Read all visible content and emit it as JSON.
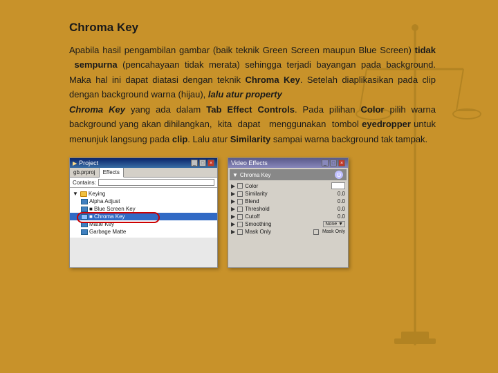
{
  "page": {
    "background_color": "#c8922a"
  },
  "title": "Chroma Key",
  "paragraph": {
    "text_parts": [
      {
        "text": "Apabila hasil pengambilan gambar (baik teknik Green Screen maupun Blue Screen) ",
        "style": "normal"
      },
      {
        "text": "tidak sempurna",
        "style": "bold"
      },
      {
        "text": " (pencahayaan tidak merata) sehingga terjadi bayangan pada background. Maka hal ini dapat diatasi dengan teknik ",
        "style": "normal"
      },
      {
        "text": "Chroma Key",
        "style": "bold"
      },
      {
        "text": ". Setelah diaplikasikan pada clip dengan background warna (hijau), ",
        "style": "normal"
      },
      {
        "text": "lalu atur property Chroma Key",
        "style": "bold-italic"
      },
      {
        "text": " yang ada dalam ",
        "style": "normal"
      },
      {
        "text": "Tab Effect Controls",
        "style": "bold"
      },
      {
        "text": ". Pada pilihan ",
        "style": "normal"
      },
      {
        "text": "Color",
        "style": "bold"
      },
      {
        "text": " pilih warna background yang akan dihilangkan, kita dapat menggunakan tombol ",
        "style": "normal"
      },
      {
        "text": "eyedropper",
        "style": "bold"
      },
      {
        "text": " untuk menunjuk langsung pada ",
        "style": "normal"
      },
      {
        "text": "clip",
        "style": "bold"
      },
      {
        "text": ". Lalu atur ",
        "style": "normal"
      },
      {
        "text": "Similarity",
        "style": "bold"
      },
      {
        "text": " sampai warna background tak tampak.",
        "style": "normal"
      }
    ]
  },
  "left_screenshot": {
    "title": "Project",
    "tab": "Effects",
    "search_label": "Contains:",
    "tree_items": [
      {
        "label": "Keying",
        "type": "folder",
        "indent": 0
      },
      {
        "label": "Alpha Adjust",
        "type": "item",
        "indent": 1
      },
      {
        "label": "Blue Screen Key",
        "type": "item",
        "indent": 1,
        "selected": false
      },
      {
        "label": "Chroma Key",
        "type": "item",
        "indent": 1,
        "selected": true
      },
      {
        "label": "Matte Key",
        "type": "item",
        "indent": 1,
        "selected": false
      },
      {
        "label": "Garbage Matte",
        "type": "item",
        "indent": 1,
        "selected": false
      }
    ]
  },
  "right_screenshot": {
    "title": "Video Effects",
    "section": "Chroma Key",
    "rows": [
      {
        "label": "Color",
        "value": "",
        "has_eyedropper": true
      },
      {
        "label": "Similarity",
        "value": "0.0"
      },
      {
        "label": "Blend",
        "value": "0.0"
      },
      {
        "label": "Threshold",
        "value": "0.0"
      },
      {
        "label": "Cutoff",
        "value": "0.0"
      },
      {
        "label": "Smoothing",
        "value": "None",
        "has_dropdown": true
      },
      {
        "label": "Mask Only",
        "value": "Mask Only",
        "has_checkbox": true
      }
    ]
  }
}
